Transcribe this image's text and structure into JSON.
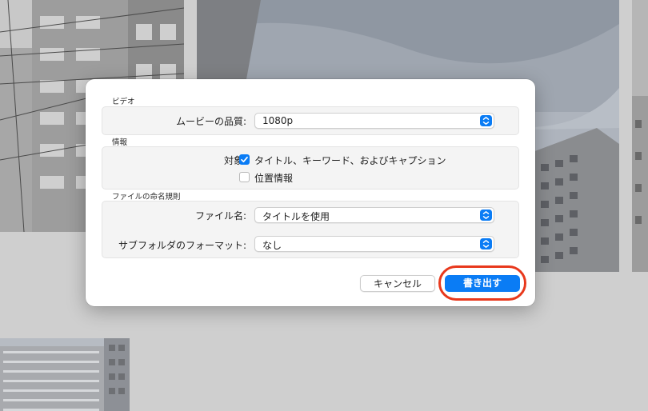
{
  "dialog": {
    "video": {
      "section_title": "ビデオ",
      "quality_label": "ムービーの品質:",
      "quality_value": "1080p"
    },
    "info": {
      "section_title": "情報",
      "include_label": "対象:",
      "include_options": [
        {
          "label": "タイトル、キーワード、およびキャプション",
          "checked": true
        },
        {
          "label": "位置情報",
          "checked": false
        }
      ]
    },
    "naming": {
      "section_title": "ファイルの命名規則",
      "filename_label": "ファイル名:",
      "filename_value": "タイトルを使用",
      "subfolder_label": "サブフォルダのフォーマット:",
      "subfolder_value": "なし"
    },
    "buttons": {
      "cancel": "キャンセル",
      "export": "書き出す"
    }
  },
  "colors": {
    "accent": "#0a7cf5",
    "highlight": "#e8381c"
  },
  "icons": {
    "popup": "chevron-up-down-icon",
    "checkbox": "checkmark-icon"
  }
}
